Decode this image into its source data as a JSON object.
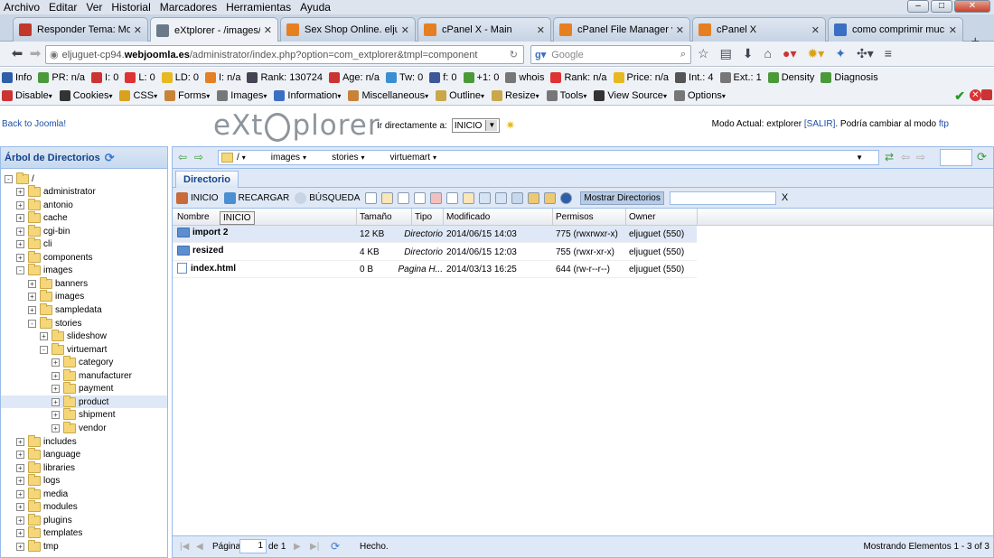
{
  "menubar": [
    "Archivo",
    "Editar",
    "Ver",
    "Historial",
    "Marcadores",
    "Herramientas",
    "Ayuda"
  ],
  "tabs": [
    {
      "label": "Responder Tema: Mo...",
      "color": "#c0392b"
    },
    {
      "label": "eXtplorer - /images/st...",
      "color": "#6b7a8a"
    },
    {
      "label": "Sex Shop Online. eljug...",
      "color": "#e67e22"
    },
    {
      "label": "cPanel X - Main",
      "color": "#e67e22"
    },
    {
      "label": "cPanel File Manager v3",
      "color": "#e67e22"
    },
    {
      "label": "cPanel X",
      "color": "#e67e22"
    },
    {
      "label": "como comprimir muc...",
      "color": "#3b6fc4"
    }
  ],
  "url": {
    "pre": "eljuguet-cp94.",
    "domain": "webjoomla.es",
    "post": "/administrator/index.php?option=com_extplorer&tmpl=component"
  },
  "search_placeholder": "Google",
  "seo": [
    "Info",
    "PR: n/a",
    "I: 0",
    "L: 0",
    "LD: 0",
    "I: n/a",
    "Rank: 130724",
    "Age: n/a",
    "Tw: 0",
    "f: 0",
    "+1: 0",
    "whois",
    "Rank: n/a",
    "Price: n/a",
    "Int.: 4",
    "Ext.: 1",
    "Density",
    "Diagnosis"
  ],
  "dev": [
    "Disable",
    "Cookies",
    "CSS",
    "Forms",
    "Images",
    "Information",
    "Miscellaneous",
    "Outline",
    "Resize",
    "Tools",
    "View Source",
    "Options"
  ],
  "app": {
    "back": "Back to Joomla!",
    "logo_a": "eXt",
    "logo_b": "plorer",
    "goto_label": "Ir directamente a:",
    "goto_value": "INICIO",
    "mode_text": "Modo Actual: extplorer",
    "mode_salir": "[SALIR]",
    "mode_rest": ". Podría cambiar al modo",
    "mode_ftp": "ftp"
  },
  "left": {
    "title": "Árbol de Directorios",
    "tree": [
      {
        "label": "/",
        "lvl": 0,
        "pm": "-"
      },
      {
        "label": "administrator",
        "lvl": 1,
        "pm": "+"
      },
      {
        "label": "antonio",
        "lvl": 1,
        "pm": "+"
      },
      {
        "label": "cache",
        "lvl": 1,
        "pm": "+"
      },
      {
        "label": "cgi-bin",
        "lvl": 1,
        "pm": "+"
      },
      {
        "label": "cli",
        "lvl": 1,
        "pm": "+"
      },
      {
        "label": "components",
        "lvl": 1,
        "pm": "+"
      },
      {
        "label": "images",
        "lvl": 1,
        "pm": "-"
      },
      {
        "label": "banners",
        "lvl": 2,
        "pm": "+"
      },
      {
        "label": "images",
        "lvl": 2,
        "pm": "+"
      },
      {
        "label": "sampledata",
        "lvl": 2,
        "pm": "+"
      },
      {
        "label": "stories",
        "lvl": 2,
        "pm": "-"
      },
      {
        "label": "slideshow",
        "lvl": 3,
        "pm": "+"
      },
      {
        "label": "virtuemart",
        "lvl": 3,
        "pm": "-"
      },
      {
        "label": "category",
        "lvl": 4,
        "pm": "+"
      },
      {
        "label": "manufacturer",
        "lvl": 4,
        "pm": "+"
      },
      {
        "label": "payment",
        "lvl": 4,
        "pm": "+"
      },
      {
        "label": "product",
        "lvl": 4,
        "pm": "+",
        "selected": true
      },
      {
        "label": "shipment",
        "lvl": 4,
        "pm": "+"
      },
      {
        "label": "vendor",
        "lvl": 4,
        "pm": "+"
      },
      {
        "label": "includes",
        "lvl": 1,
        "pm": "+"
      },
      {
        "label": "language",
        "lvl": 1,
        "pm": "+"
      },
      {
        "label": "libraries",
        "lvl": 1,
        "pm": "+"
      },
      {
        "label": "logs",
        "lvl": 1,
        "pm": "+"
      },
      {
        "label": "media",
        "lvl": 1,
        "pm": "+"
      },
      {
        "label": "modules",
        "lvl": 1,
        "pm": "+"
      },
      {
        "label": "plugins",
        "lvl": 1,
        "pm": "+"
      },
      {
        "label": "templates",
        "lvl": 1,
        "pm": "+"
      },
      {
        "label": "tmp",
        "lvl": 1,
        "pm": "+"
      }
    ]
  },
  "right": {
    "crumbs": [
      "/",
      "images",
      "stories",
      "virtuemart"
    ],
    "tab": "Directorio",
    "inicio": "INICIO",
    "recargar": "RECARGAR",
    "busqueda": "BÚSQUEDA",
    "mostrar": "Mostrar Directorios",
    "clear": "X",
    "tooltip": "INICIO",
    "cols": [
      "Nombre",
      "Tamaño",
      "Tipo",
      "Modificado",
      "Permisos",
      "Owner"
    ],
    "rows": [
      {
        "name": "import 2",
        "size": "12 KB",
        "type": "Directorio",
        "mod": "2014/06/15 14:03",
        "perm": "775 (rwxrwxr-x)",
        "owner": "eljuguet (550)",
        "kind": "dir",
        "selected": true
      },
      {
        "name": "resized",
        "size": "4 KB",
        "type": "Directorio",
        "mod": "2014/06/15 12:03",
        "perm": "755 (rwxr-xr-x)",
        "owner": "eljuguet (550)",
        "kind": "dir"
      },
      {
        "name": "index.html",
        "size": "0 B",
        "type": "Pagina H...",
        "mod": "2014/03/13 16:25",
        "perm": "644 (rw-r--r--)",
        "owner": "eljuguet (550)",
        "kind": "file"
      }
    ],
    "status": {
      "pagina": "Página",
      "page": "1",
      "de": "de 1",
      "hecho": "Hecho.",
      "mostrando": "Mostrando Elementos 1 - 3 of 3"
    }
  }
}
